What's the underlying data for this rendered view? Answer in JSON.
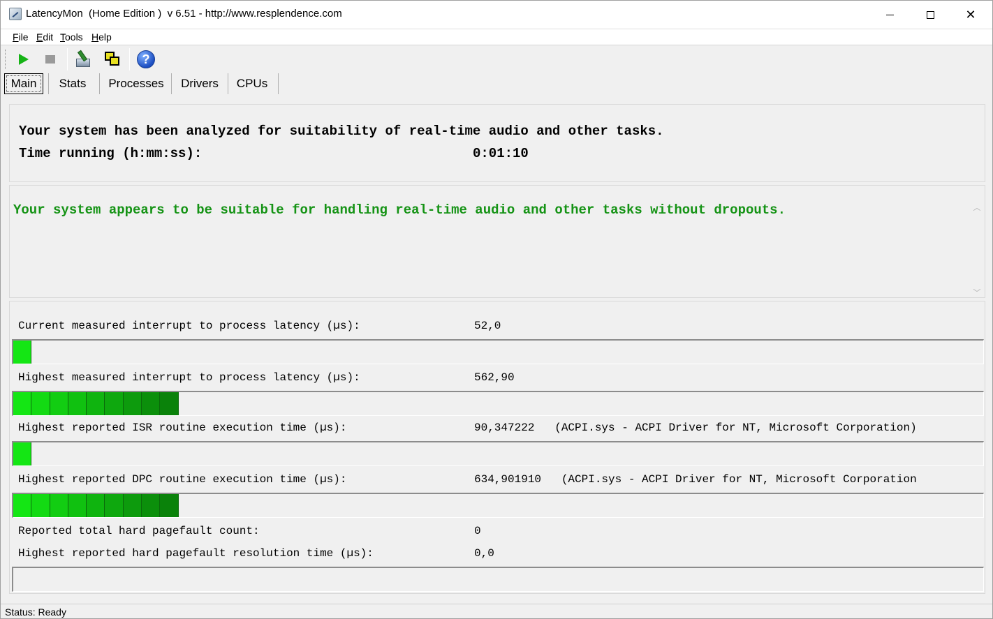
{
  "window": {
    "title": "LatencyMon  (Home Edition )  v 6.51 - http://www.resplendence.com"
  },
  "menu": {
    "items": [
      "File",
      "Edit",
      "Tools",
      "Help"
    ]
  },
  "toolbar": {
    "icons": [
      "play-icon",
      "stop-icon",
      "tools-icon",
      "windows-icon",
      "help-icon"
    ],
    "help_glyph": "?"
  },
  "tabs": {
    "items": [
      "Main",
      "Stats",
      "Processes",
      "Drivers",
      "CPUs"
    ],
    "active": "Main"
  },
  "summary": {
    "analyzed_text": "Your system has been analyzed for suitability of real-time audio and other tasks.",
    "time_running_label": "Time running (h:mm:ss):",
    "time_running_value": "0:01:10"
  },
  "verdict": {
    "message": "Your system appears to be suitable for handling real-time audio and other tasks without dropouts.",
    "color": "#159315"
  },
  "metrics": {
    "current_latency": {
      "label": "Current measured interrupt to process latency (µs):",
      "value": "52,0",
      "segments": 1
    },
    "highest_latency": {
      "label": "Highest measured interrupt to process latency (µs):",
      "value": "562,90",
      "segments": 9
    },
    "isr": {
      "label": "Highest reported ISR routine execution time (µs):",
      "value": "90,347222   (ACPI.sys - ACPI Driver for NT, Microsoft Corporation)",
      "segments": 1
    },
    "dpc": {
      "label": "Highest reported DPC routine execution time (µs):",
      "value": "634,901910   (ACPI.sys - ACPI Driver for NT, Microsoft Corporation",
      "segments": 9
    },
    "pagefault_count": {
      "label": "Reported total hard pagefault count:",
      "value": "0"
    },
    "pagefault_time": {
      "label": "Highest reported hard pagefault resolution time (µs):",
      "value": "0,0",
      "segments": 0
    }
  },
  "status": {
    "text": "Status: Ready"
  }
}
